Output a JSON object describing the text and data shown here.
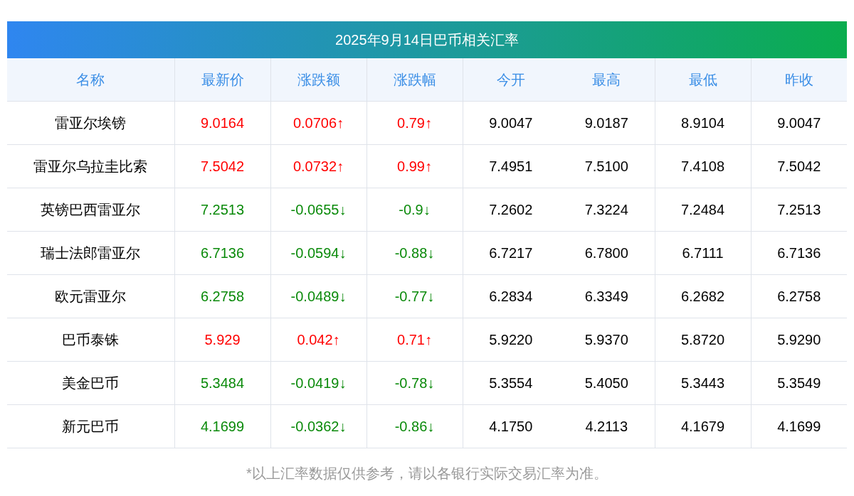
{
  "title": "2025年9月14日巴币相关汇率",
  "columns": [
    "名称",
    "最新价",
    "涨跌额",
    "涨跌幅",
    "今开",
    "最高",
    "最低",
    "昨收"
  ],
  "rows": [
    {
      "rising": true,
      "cells": [
        "雷亚尔埃镑",
        "9.0164",
        "0.0706↑",
        "0.79↑",
        "9.0047",
        "9.0187",
        "8.9104",
        "9.0047"
      ]
    },
    {
      "rising": true,
      "cells": [
        "雷亚尔乌拉圭比索",
        "7.5042",
        "0.0732↑",
        "0.99↑",
        "7.4951",
        "7.5100",
        "7.4108",
        "7.5042"
      ]
    },
    {
      "rising": false,
      "cells": [
        "英镑巴西雷亚尔",
        "7.2513",
        "-0.0655↓",
        "-0.9↓",
        "7.2602",
        "7.3224",
        "7.2484",
        "7.2513"
      ]
    },
    {
      "rising": false,
      "cells": [
        "瑞士法郎雷亚尔",
        "6.7136",
        "-0.0594↓",
        "-0.88↓",
        "6.7217",
        "6.7800",
        "6.7111",
        "6.7136"
      ]
    },
    {
      "rising": false,
      "cells": [
        "欧元雷亚尔",
        "6.2758",
        "-0.0489↓",
        "-0.77↓",
        "6.2834",
        "6.3349",
        "6.2682",
        "6.2758"
      ]
    },
    {
      "rising": true,
      "cells": [
        "巴币泰铢",
        "5.929",
        "0.042↑",
        "0.71↑",
        "5.9220",
        "5.9370",
        "5.8720",
        "5.9290"
      ]
    },
    {
      "rising": false,
      "cells": [
        "美金巴币",
        "5.3484",
        "-0.0419↓",
        "-0.78↓",
        "5.3554",
        "5.4050",
        "5.3443",
        "5.3549"
      ]
    },
    {
      "rising": false,
      "cells": [
        "新元巴币",
        "4.1699",
        "-0.0362↓",
        "-0.86↓",
        "4.1750",
        "4.2113",
        "4.1679",
        "4.1699"
      ]
    }
  ],
  "footnote": "*以上汇率数据仅供参考，请以各银行实际交易汇率为准。"
}
